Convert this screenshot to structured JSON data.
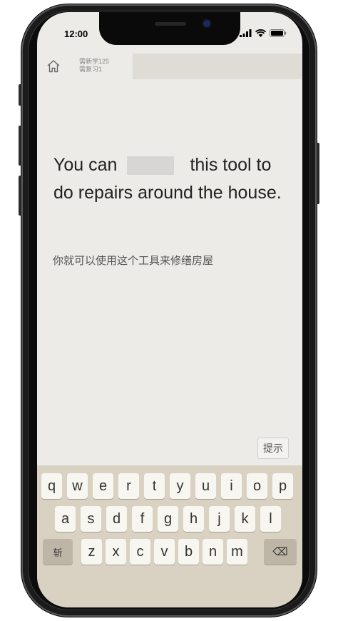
{
  "status_bar": {
    "time": "12:00"
  },
  "header": {
    "new_count": "需新学125",
    "review_count": "需复习1"
  },
  "sentence": {
    "before_blank": "You can",
    "after_blank": "this tool to do repairs around the house."
  },
  "translation": "你就可以使用这个工具来修缮房屋",
  "hint_button": "提示",
  "keyboard": {
    "row1": [
      "q",
      "w",
      "e",
      "r",
      "t",
      "y",
      "u",
      "i",
      "o",
      "p"
    ],
    "row2": [
      "a",
      "s",
      "d",
      "f",
      "g",
      "h",
      "j",
      "k",
      "l"
    ],
    "row3": [
      "z",
      "x",
      "c",
      "v",
      "b",
      "n",
      "m"
    ],
    "mode_key": "斩",
    "delete_key": "⌫"
  }
}
